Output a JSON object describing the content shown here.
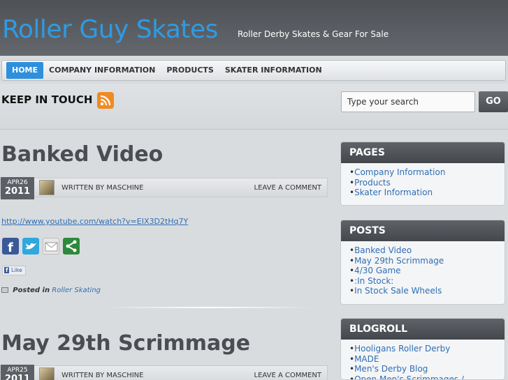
{
  "site": {
    "title": "Roller Guy Skates",
    "tagline": "Roller Derby Skates & Gear For Sale"
  },
  "nav": {
    "items": [
      {
        "label": "HOME",
        "active": true
      },
      {
        "label": "COMPANY INFORMATION",
        "active": false
      },
      {
        "label": "PRODUCTS",
        "active": false
      },
      {
        "label": "SKATER INFORMATION",
        "active": false
      }
    ]
  },
  "topbar": {
    "keep_in_touch": "KEEP IN TOUCH",
    "rss_icon": "rss-icon"
  },
  "search": {
    "value": "Type your search",
    "button_label": "GO"
  },
  "posts": [
    {
      "title": "Banked Video",
      "date_md": "APR26",
      "date_year": "2011",
      "written_by": "WRITTEN BY MASCHINE",
      "leave_comment": "LEAVE A COMMENT",
      "link": "http://www.youtube.com/watch?v=EIX3D2tHq7Y",
      "like_label": "Like",
      "posted_in_label": "Posted in",
      "category": "Roller Skating"
    },
    {
      "title": "May 29th Scrimmage",
      "date_md": "APR25",
      "date_year": "2011",
      "written_by": "WRITTEN BY MASCHINE",
      "leave_comment": "LEAVE A COMMENT"
    }
  ],
  "share_icons": [
    "facebook-icon",
    "twitter-icon",
    "email-icon",
    "share-icon"
  ],
  "sidebar": {
    "pages": {
      "title": "PAGES",
      "items": [
        "Company Information",
        "Products",
        "Skater Information"
      ]
    },
    "posts": {
      "title": "POSTS",
      "items": [
        "Banked Video",
        "May 29th Scrimmage",
        "4/30 Game",
        ":In Stock:",
        "In Stock Sale Wheels"
      ]
    },
    "blogroll": {
      "title": "BLOGROLL",
      "items": [
        "Hooligans Roller Derby",
        "MADE",
        "Men's Derby Blog",
        "Open Men's Scrimmages /"
      ]
    }
  },
  "colors": {
    "accent": "#2e8fdd",
    "title_blue": "#2f9be3",
    "header_dark": "#55595e",
    "link": "#2e6fb5"
  }
}
